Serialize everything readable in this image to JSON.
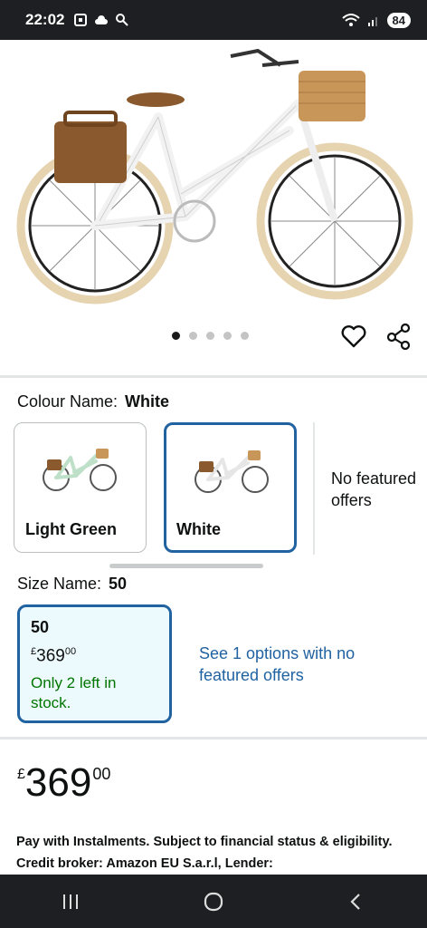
{
  "status_bar": {
    "time": "22:02",
    "battery": "84"
  },
  "gallery": {
    "image_count": 5,
    "active_index": 0
  },
  "colour": {
    "label": "Colour Name:",
    "selected": "White",
    "options": [
      {
        "name": "Light Green",
        "frame_color": "#cfe7d6"
      },
      {
        "name": "White",
        "frame_color": "#f4f4f4"
      }
    ],
    "no_featured_offers": [
      "No featured",
      "offers"
    ]
  },
  "size": {
    "label": "Size Name:",
    "selected": "50",
    "card": {
      "size": "50",
      "price_currency": "£",
      "price_whole": "369",
      "price_fraction": "00",
      "stock": [
        "Only 2 left in",
        "stock."
      ]
    },
    "see_options": "See 1 options with no featured offers"
  },
  "price": {
    "currency": "£",
    "whole": "369",
    "fraction": "00"
  },
  "instalments": "Pay with Instalments. Subject to financial status & eligibility. Credit broker: Amazon EU S.a.r.l, Lender:",
  "colors": {
    "accent_blue": "#2162a1",
    "stock_green": "#007600",
    "selected_bg": "#edfafd"
  }
}
